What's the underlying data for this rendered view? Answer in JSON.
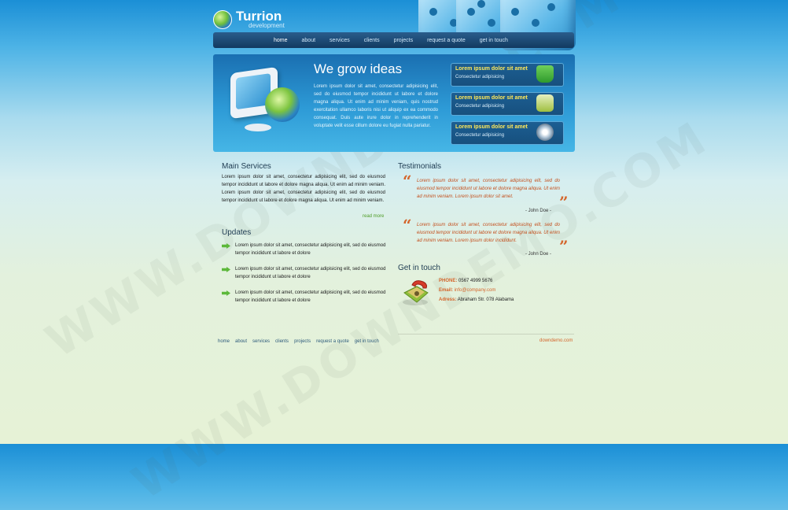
{
  "site": {
    "title": "Turrion",
    "subtitle": "development"
  },
  "nav": {
    "items": [
      "home",
      "about",
      "services",
      "clients",
      "projects",
      "request a quote",
      "get in touch"
    ],
    "active": "home"
  },
  "hero": {
    "title": "We grow ideas",
    "text": "Lorem ipsum dolor sit amet, consectetur adipisicing elit, sed do eiusmod tempor incididunt ut labore et dolore magna aliqua. Ut enim ad minim veniam, quis nostrud exercitation ullamco laboris nisi ut aliquip ex ea commodo consequat. Duis aute irure dolor in reprehenderit in voluptate velit esse cillum dolore eu fugiat nulla pariatur.",
    "boxes": [
      {
        "title": "Lorem ipsum dolor sit amet",
        "subtitle": "Consectetur adipisicing",
        "icon": "cup-icon"
      },
      {
        "title": "Lorem ipsum dolor sit amet",
        "subtitle": "Consectetur adipisicing",
        "icon": "laptop-icon"
      },
      {
        "title": "Lorem ipsum dolor sit amet",
        "subtitle": "Consectetur adipisicing",
        "icon": "eye-icon"
      }
    ]
  },
  "main_services": {
    "heading": "Main Services",
    "text": "Lorem ipsum dolor sit amet, consectetur adipisicing elit, sed do eiusmod tempor incididunt ut labore et dolore magna aliqua. Ut enim ad minim veniam. Lorem ipsum dolor sit amet, consectetur adipisicing elit, sed do eiusmod tempor incididunt ut labore et dolore magna aliqua. Ut enim ad minim veniam.",
    "read_more": "read more"
  },
  "updates": {
    "heading": "Updates",
    "items": [
      "Lorem ipsum dolor sit amet, consectetur adipisicing elit, sed do eiusmod tempor incididunt ut labore et dolore",
      "Lorem ipsum dolor sit amet, consectetur adipisicing elit, sed do eiusmod tempor incididunt ut labore et dolore",
      "Lorem ipsum dolor sit amet, consectetur adipisicing elit, sed do eiusmod tempor incididunt ut labore et dolore"
    ]
  },
  "testimonials": {
    "heading": "Testimonials",
    "items": [
      {
        "text": "Lorem ipsum dolor sit amet, consectetur adipisicing elit, sed do eiusmod tempor incididunt ut labore et dolore magna aliqua. Ut enim ad minim veniam. Lorem ipsum dolor sit amet.",
        "author": "- John Doe -"
      },
      {
        "text": "Lorem ipsum dolor sit amet, consectetur adipisicing elit, sed do eiusmod tempor incididunt ut labore et dolore magna aliqua. Ut enim ad minim veniam. Lorem ipsum dolor incididunt.",
        "author": "- John Doe -"
      }
    ]
  },
  "contact": {
    "heading": "Get in touch",
    "phone_label": "PHONE:",
    "phone": "0567 4999 5676",
    "email_label": "Email:",
    "email": "info@company.com",
    "address_label": "Adress:",
    "address": "Abraham Str. 078 Alabama"
  },
  "footer": {
    "links": [
      "home",
      "about",
      "services",
      "clients",
      "projects",
      "request a quote",
      "get in touch"
    ],
    "credit": "downdemo.com"
  },
  "watermark": "WWW.DOWNDEMO.COM",
  "colors": {
    "accent": "#d4652b",
    "hero_box_title": "#ffe85a",
    "update_arrow": "#5cb83a"
  }
}
